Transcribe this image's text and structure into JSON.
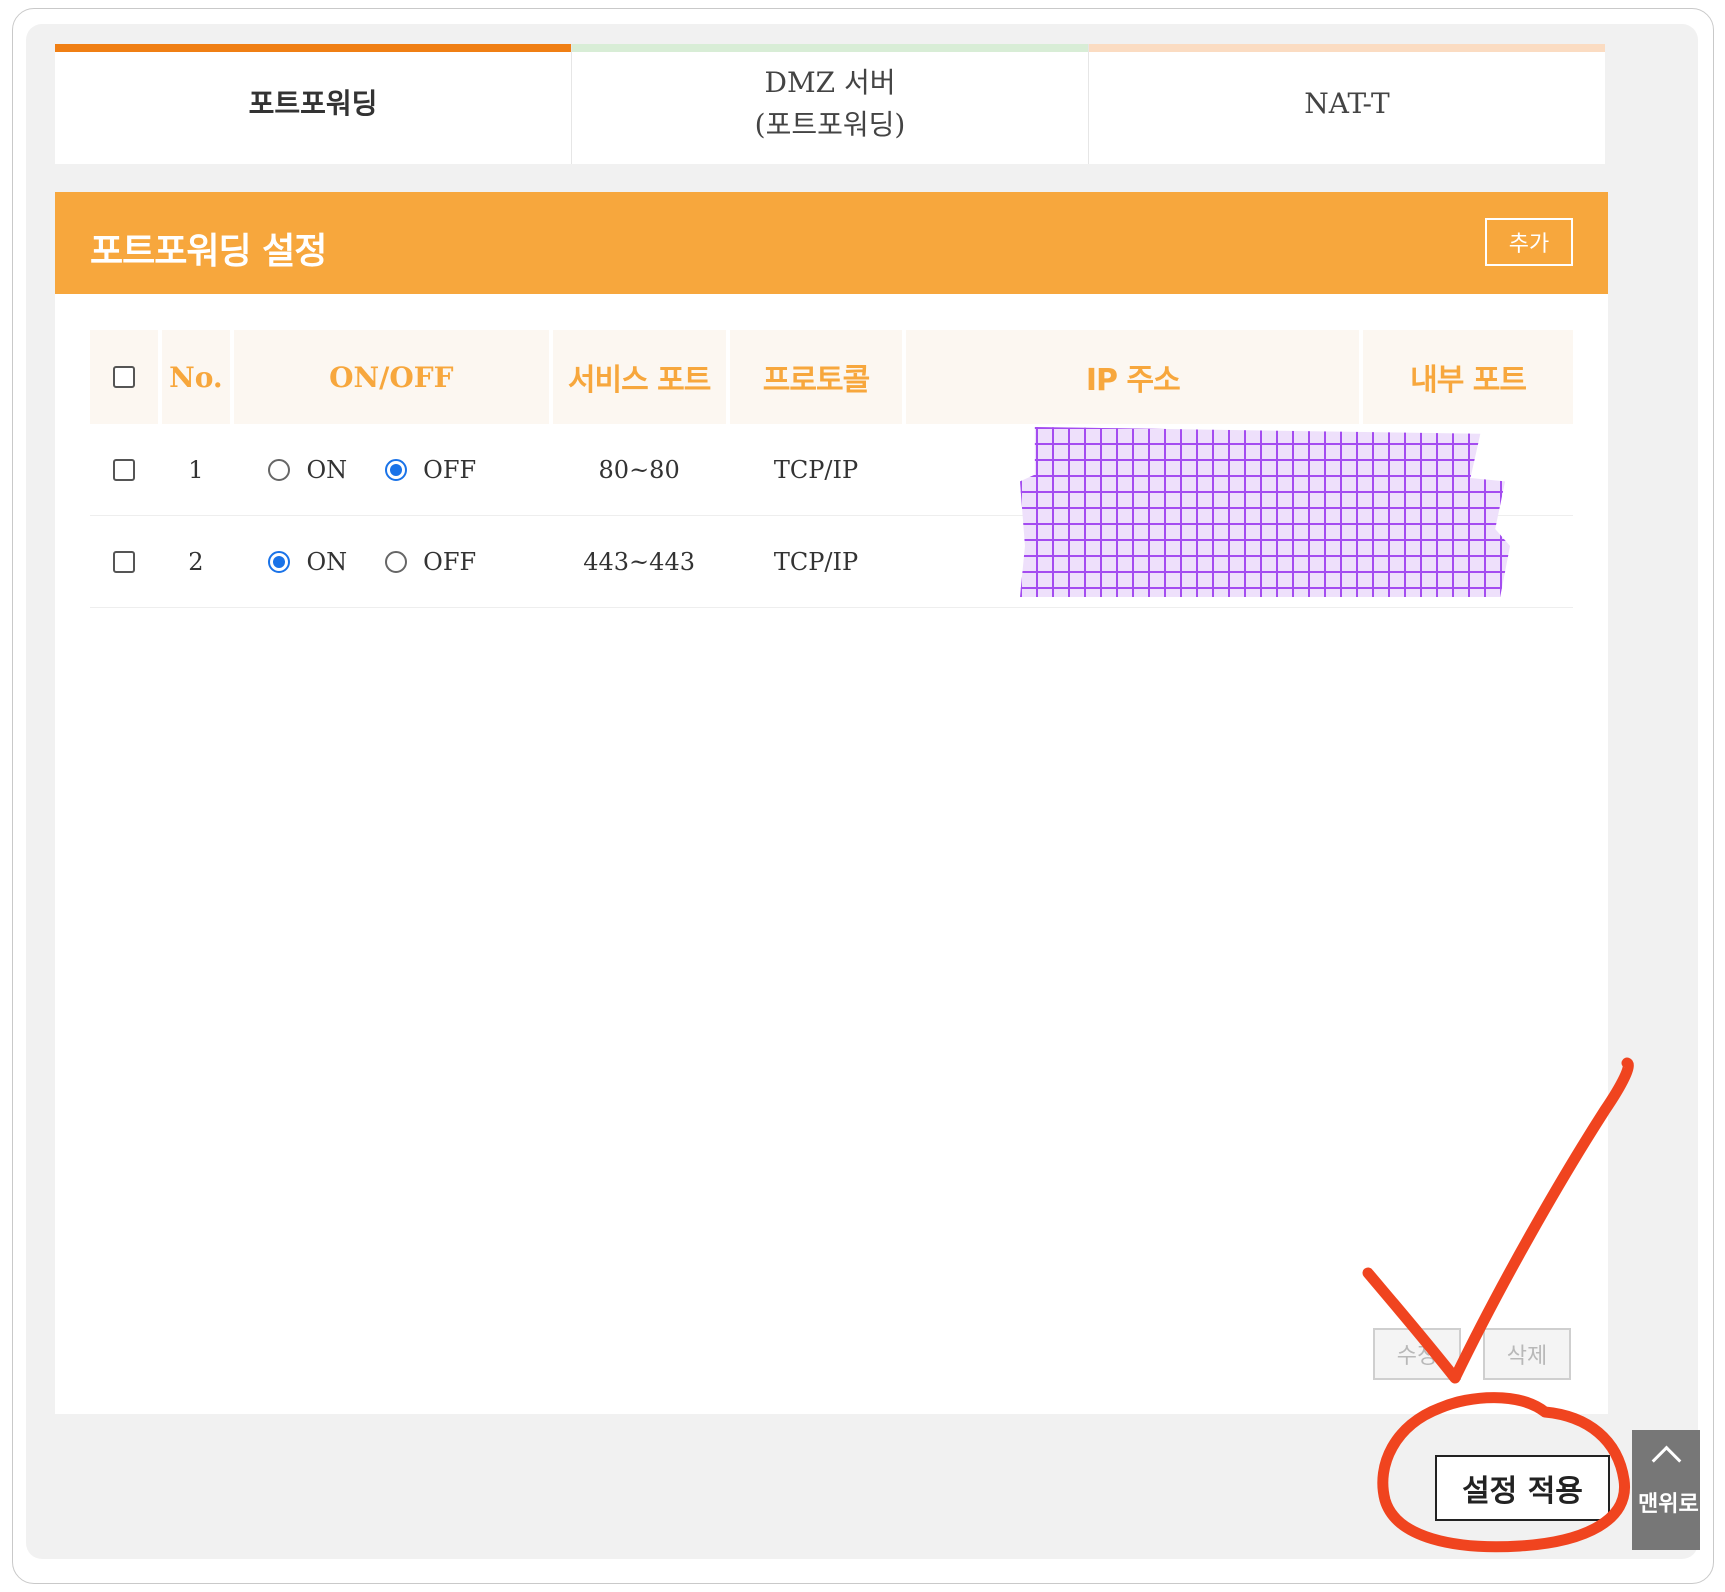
{
  "tabs": [
    {
      "label": "포트포워딩",
      "bar_color": "#f07f14"
    },
    {
      "label": "DMZ 서버\n(포트포워딩)",
      "bar_color": "#d8edd6"
    },
    {
      "label": "NAT-T",
      "bar_color": "#fbdcc2"
    }
  ],
  "card": {
    "title": "포트포워딩 설정",
    "add_label": "추가",
    "header_color": "#f7a73d"
  },
  "table": {
    "headers": [
      "No.",
      "ON/OFF",
      "서비스 포트",
      "프로토콜",
      "IP 주소",
      "내부 포트"
    ],
    "on_label": "ON",
    "off_label": "OFF",
    "rows": [
      {
        "no": "1",
        "state": "OFF",
        "service_port": "80~80",
        "protocol": "TCP/IP"
      },
      {
        "no": "2",
        "state": "ON",
        "service_port": "443~443",
        "protocol": "TCP/IP"
      }
    ]
  },
  "actions": {
    "edit_label": "수정",
    "delete_label": "삭제",
    "apply_label": "설정 적용",
    "top_label": "맨위로"
  },
  "annotation_color": "#f0441f"
}
